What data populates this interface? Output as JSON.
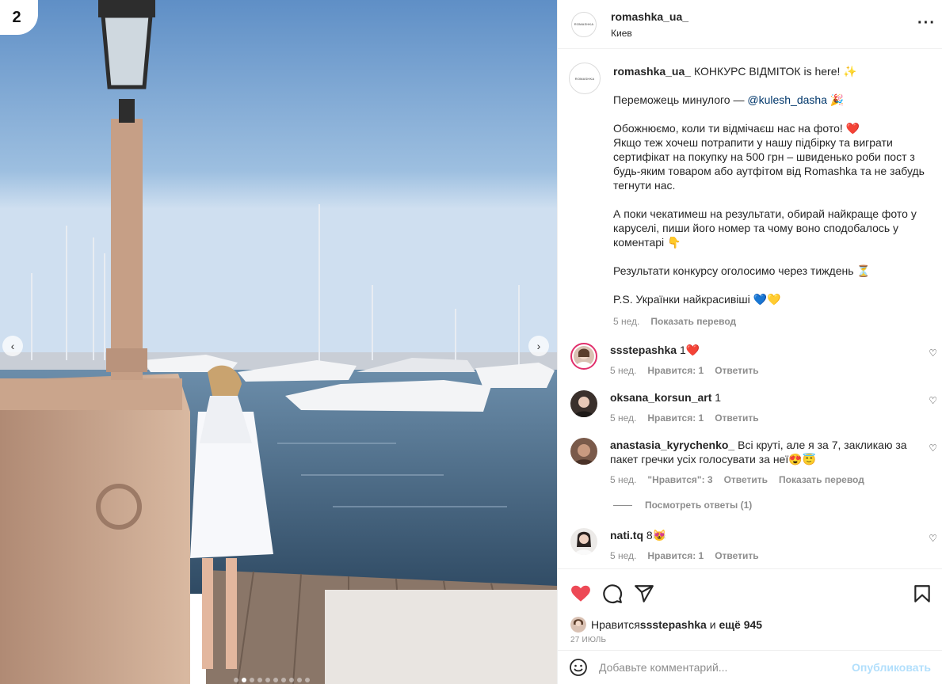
{
  "photo": {
    "number": "2",
    "slides_total": 10,
    "active_slide": 1
  },
  "header": {
    "avatar_text": "ROMASHKA",
    "username": "romashka_ua_",
    "location": "Киев"
  },
  "caption": {
    "avatar_text": "ROMASHKA",
    "username": "romashka_ua_",
    "line1": " КОНКУРС ВІДМІТОК is here! ✨",
    "line2_prefix": "Переможець минулого — ",
    "line2_mention": "@kulesh_dasha",
    "line2_suffix": " 🎉",
    "para3": "Обожнюємо, коли ти відмічаєш нас на фото! ❤️\nЯкщо теж хочеш потрапити у нашу підбірку та виграти сертифікат на покупку на 500 грн – швиденько роби пост з будь-яким товаром або аутфітом від Romashka та не забудь тегнути нас.",
    "para4": "А поки чекатимеш на результати, обирай найкраще фото у каруселі, пиши його номер та чому воно сподобалось у коментарі 👇",
    "para5": "Результати конкурсу оголосимо через тиждень ⏳",
    "para6": "P.S. Українки найкрасивіші 💙💛",
    "time": "5 нед.",
    "translate": "Показать перевод"
  },
  "comments": [
    {
      "username": "ssstepashka",
      "text": " 1❤️",
      "time": "5 нед.",
      "likes": "Нравится: 1",
      "reply": "Ответить"
    },
    {
      "username": "oksana_korsun_art",
      "text": " 1",
      "time": "5 нед.",
      "likes": "Нравится: 1",
      "reply": "Ответить"
    },
    {
      "username": "anastasia_kyrychenko_",
      "text": " Всі круті, але я за 7, закликаю за пакет гречки усіх голосувати за неї😍😇",
      "time": "5 нед.",
      "likes": "\"Нравится\": 3",
      "reply": "Ответить",
      "translate": "Показать перевод"
    },
    {
      "username": "nati.tq",
      "text": " 8😻",
      "time": "5 нед.",
      "likes": "Нравится: 1",
      "reply": "Ответить"
    }
  ],
  "replies_link": "Посмотреть ответы (1)",
  "likes": {
    "prefix": "Нравится ",
    "user": "ssstepashka",
    "middle": " и ",
    "others": "ещё 945"
  },
  "date": "27 ИЮЛЬ",
  "comment_box": {
    "placeholder": "Добавьте комментарий...",
    "post_label": "Опубликовать"
  },
  "colors": {
    "like_red": "#ed4956",
    "mention": "#00376b",
    "post_disabled": "#b2dffc",
    "muted": "#8e8e8e"
  },
  "icons": [
    "chevron-left-icon",
    "chevron-right-icon",
    "more-icon",
    "heart-icon",
    "comment-icon",
    "share-icon",
    "bookmark-icon",
    "emoji-icon"
  ]
}
